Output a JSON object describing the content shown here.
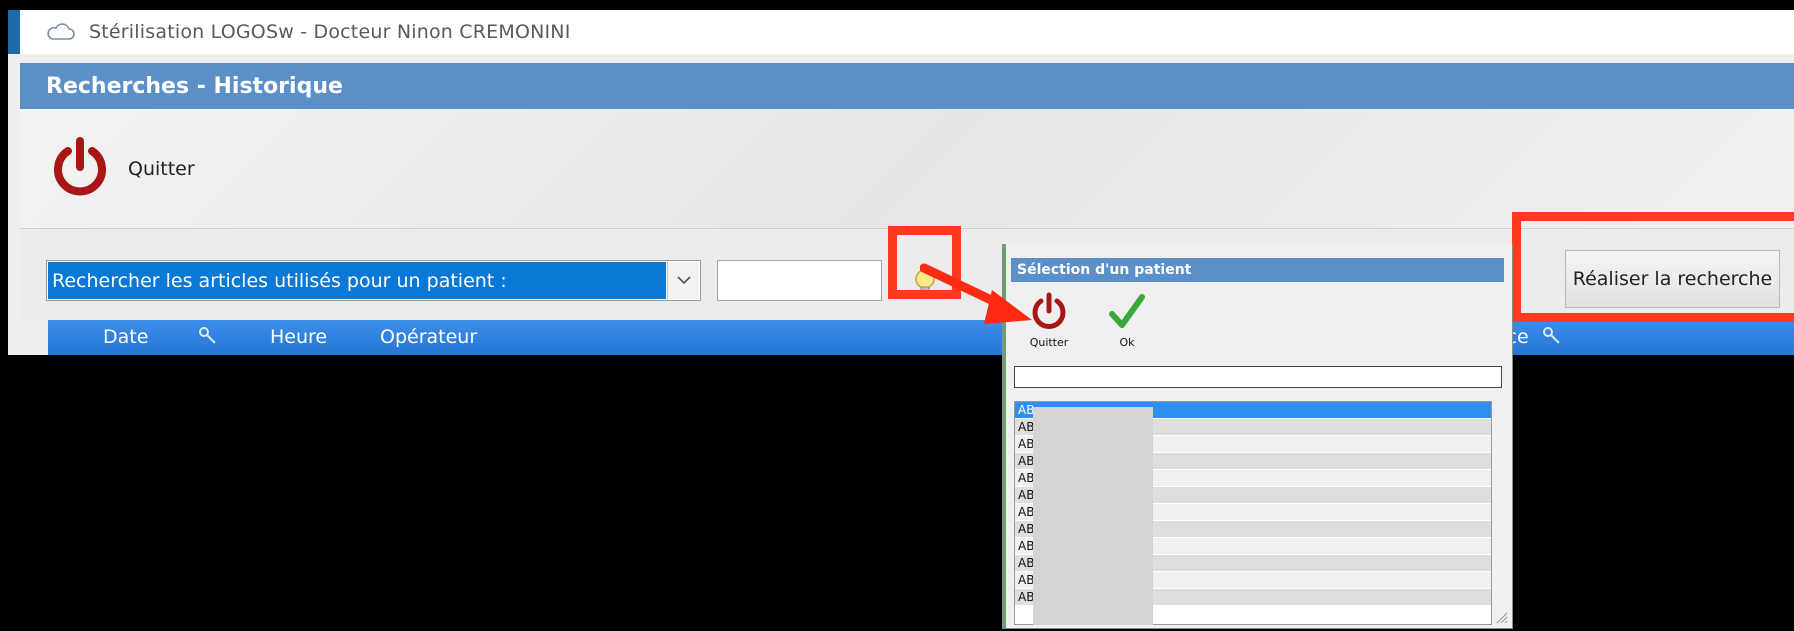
{
  "window": {
    "title": "Stérilisation LOGOSw - Docteur Ninon CREMONINI",
    "section_title": "Recherches - Historique"
  },
  "toolbar": {
    "quit_label": "Quitter"
  },
  "search": {
    "mode_value": "Rechercher les articles utilisés pour un patient :",
    "search_button_label": "Réaliser la recherche"
  },
  "grid": {
    "columns": [
      "Date",
      "Heure",
      "Opérateur",
      "Référence"
    ]
  },
  "dialog": {
    "title": "Sélection d'un patient",
    "quit_label": "Quitter",
    "ok_label": "Ok",
    "rows": [
      "AB",
      "AB",
      "AB",
      "AB",
      "AB",
      "AB",
      "AB",
      "AB",
      "AB",
      "AB",
      "AB",
      "AB"
    ]
  },
  "colors": {
    "header_blue": "#5b8fc7",
    "selection_blue": "#0a78d7",
    "highlight_red": "#ff3b1d",
    "power_red": "#b01818",
    "check_green": "#3aa83a"
  },
  "icons": [
    "cloud-icon",
    "power-icon",
    "chevron-down-icon",
    "lightbulb-icon",
    "key-icon",
    "check-icon"
  ]
}
